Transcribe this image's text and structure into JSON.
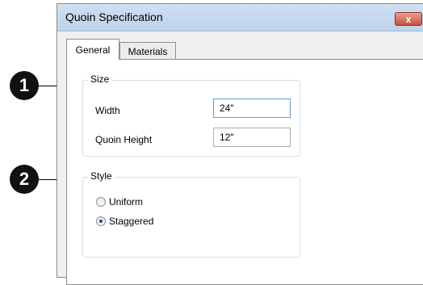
{
  "callouts": [
    "1",
    "2"
  ],
  "window": {
    "title": "Quoin Specification",
    "close_glyph": "x"
  },
  "tabs": [
    {
      "label": "General",
      "active": true
    },
    {
      "label": "Materials",
      "active": false
    }
  ],
  "size_group": {
    "legend": "Size",
    "width_label": "Width",
    "width_value": "24\"",
    "height_label": "Quoin Height",
    "height_value": "12\""
  },
  "style_group": {
    "legend": "Style",
    "options": [
      {
        "label": "Uniform",
        "checked": false
      },
      {
        "label": "Staggered",
        "checked": true
      }
    ]
  },
  "icons": {
    "close": "close-icon",
    "radio": "radio-button-icon"
  }
}
